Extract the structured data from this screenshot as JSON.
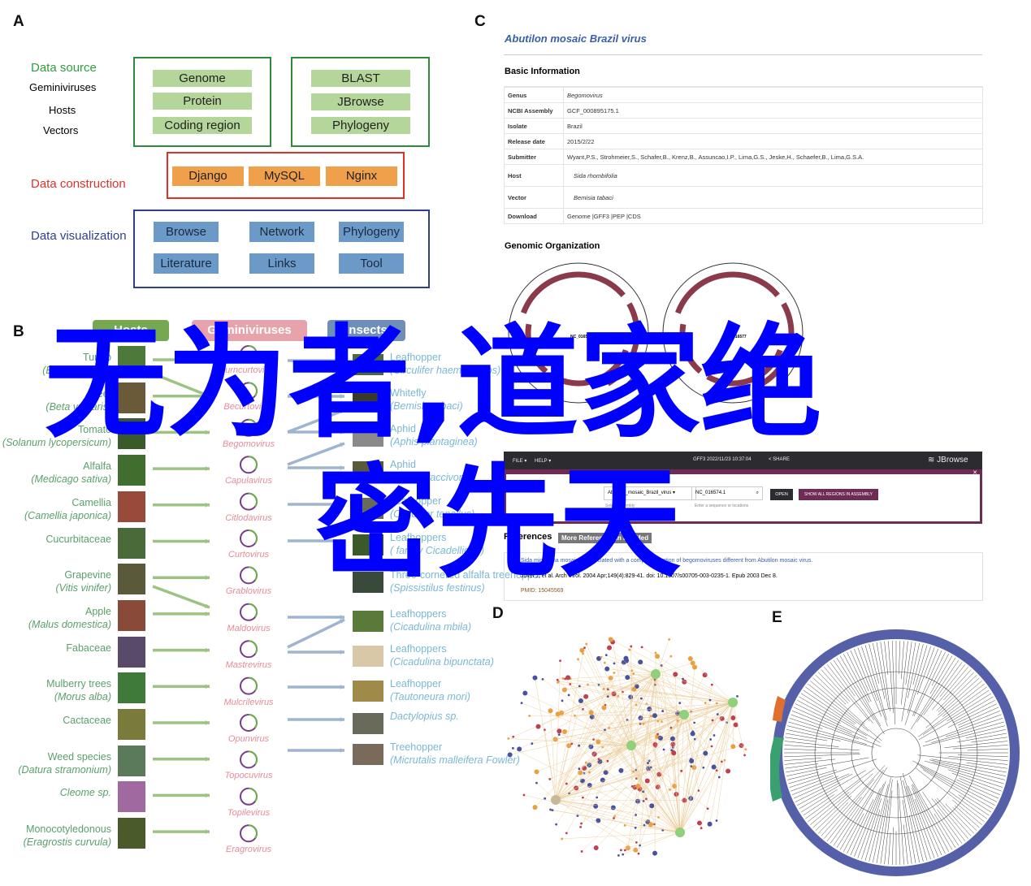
{
  "panels": {
    "a": "A",
    "b": "B",
    "c": "C",
    "d": "D",
    "e": "E"
  },
  "panelA": {
    "data_source": "Data source",
    "sources": [
      "Geminiviruses",
      "Hosts",
      "Vectors"
    ],
    "box1": [
      "Genome",
      "Protein",
      "Coding region"
    ],
    "box2": [
      "BLAST",
      "JBrowse",
      "Phylogeny"
    ],
    "data_construction": "Data construction",
    "box3": [
      "Django",
      "MySQL",
      "Nginx"
    ],
    "data_visualization": "Data visualization",
    "box4": [
      "Browse",
      "Network",
      "Phylogeny",
      "Literature",
      "Links",
      "Tool"
    ],
    "colors": {
      "source": "#2e9e3e",
      "construction": "#e0302a",
      "visualization": "#2f3f8f"
    }
  },
  "panelB": {
    "headers": {
      "hosts": "Hosts",
      "viruses": "Geminiviruses",
      "insects": "Insects"
    },
    "hosts": [
      {
        "name": "Turnip",
        "sci": "(Brassica rapa)"
      },
      {
        "name": "Beet",
        "sci": "(Beta vulgaris)"
      },
      {
        "name": "Tomato",
        "sci": "(Solanum lycopersicum)"
      },
      {
        "name": "Alfalfa",
        "sci": "(Medicago sativa)"
      },
      {
        "name": "Camellia",
        "sci": "(Camellia japonica)"
      },
      {
        "name": "Cucurbitaceae",
        "sci": ""
      },
      {
        "name": "Grapevine",
        "sci": "(Vitis vinifer)"
      },
      {
        "name": "Apple",
        "sci": "(Malus domestica)"
      },
      {
        "name": "Fabaceae",
        "sci": ""
      },
      {
        "name": "Mulberry trees",
        "sci": "(Morus alba)"
      },
      {
        "name": "Cactaceae",
        "sci": ""
      },
      {
        "name": "Weed species",
        "sci": "(Datura stramonium)"
      },
      {
        "name": "",
        "sci": "Cleome sp."
      },
      {
        "name": "Monocotyledonous",
        "sci": "(Eragrostis curvula)"
      }
    ],
    "viruses": [
      "Turncurtovirus",
      "Becurtovirus",
      "Begomovirus",
      "Capulavirus",
      "Citlodavirus",
      "Curtovirus",
      "Grablovirus",
      "Maldovirus",
      "Mastrevirus",
      "Mulcrilevirus",
      "Opunvirus",
      "Topocuvirus",
      "Topilevirus",
      "Eragrovirus"
    ],
    "insects": [
      {
        "name": "Leafhopper",
        "sci": "(Circulifer haematoceps)"
      },
      {
        "name": "Whitefly",
        "sci": "(Bemisia tabaci)"
      },
      {
        "name": "Aphid",
        "sci": "(Aphis plantaginea)"
      },
      {
        "name": "Aphid",
        "sci": "(Aphis craccivora)"
      },
      {
        "name": "Leafhopper",
        "sci": "(Circulifer tenellus)"
      },
      {
        "name": "Leafhoppers",
        "sci": "( family Cicadellidae)"
      },
      {
        "name": "Three-cornered alfalfa treehopper",
        "sci": "(Spissistilus festinus)"
      },
      {
        "name": "Leafhoppers",
        "sci": "(Cicadulina mbila)"
      },
      {
        "name": "Leafhoppers",
        "sci": "(Cicadulina bipunctata)"
      },
      {
        "name": "Leafhopper",
        "sci": "(Tautoneura mori)"
      },
      {
        "name": "",
        "sci": "Dactylopius sp."
      },
      {
        "name": "Treehopper",
        "sci": "(Micrutalis  malleifera Fowler)"
      }
    ],
    "colors": {
      "hosts": "#76a851",
      "viruses": "#e6a3ab",
      "insects": "#6f8fb8"
    }
  },
  "panelC": {
    "title": "Abutilon mosaic Brazil virus",
    "basic_info": "Basic Information",
    "rows": [
      [
        "Genus",
        "Begomovirus"
      ],
      [
        "NCBI Assembly",
        "GCF_000895175.1"
      ],
      [
        "Isolate",
        "Brazil"
      ],
      [
        "Release date",
        "2015/2/22"
      ],
      [
        "Submitter",
        "Wyant,P.S., Strohmeier,S., Schafer,B., Krenz,B., Assuncao,I.P., Lima,G.S., Jeske,H., Schaefer,B., Lima,G.S.A."
      ],
      [
        "Host",
        "Sida rhombifolia"
      ],
      [
        "Vector",
        "Bemisia tabaci"
      ],
      [
        "Download",
        "Genome |GFF3 |PEP |CDS"
      ]
    ],
    "genomic_org": "Genomic Organization",
    "segments": [
      "NC_016576",
      "NC_016577"
    ],
    "jbrowse": {
      "file": "FILE ▾",
      "help": "HELP ▾",
      "title": "GFF3 2022/11/23 10:37:04",
      "share": "SHARE",
      "brand": "JBrowse",
      "assembly_label": "Assembly",
      "assembly": "Abutilon_mosaic_Brazil_virus",
      "assembly_help": "Select assembly",
      "locus": "NC_016574.1",
      "locus_help": "Enter a sequence or locations",
      "open": "OPEN",
      "show_all": "SHOW ALL REGIONS IN ASSEMBLY"
    },
    "references": "References",
    "more_refs": "More References In PubMed",
    "ref": {
      "num": "1",
      "title": "Sida micrantha mosaic is associated with a complex infection of begomoviruses different from Abutilon mosaic virus.",
      "cite": "Jovel J, et al. Arch Virol. 2004 Apr;149(4):829-41. doi: 10.1007/s00705-003-0235-1. Epub 2003 Dec 8.",
      "pmid": "PMID: 15045569"
    }
  },
  "watermark": {
    "line1": "无为者,道家绝",
    "line2": "密先天",
    "color": "#0000ff"
  }
}
